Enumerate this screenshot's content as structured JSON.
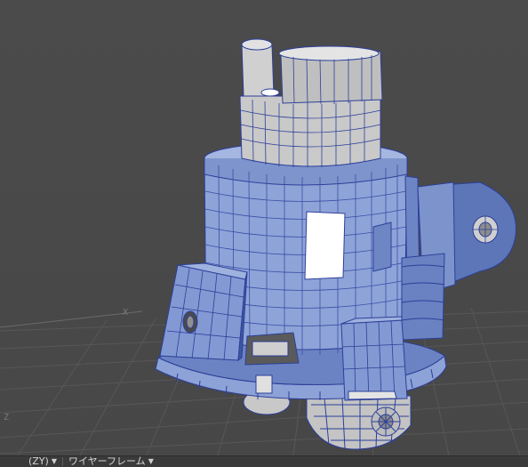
{
  "viewport": {
    "axis_labels": {
      "x_axis": "X",
      "z_axis": "Z"
    },
    "colors": {
      "background": "#4a4a4a",
      "grid": "#5a5a5a",
      "model_fill": "#7f97cf",
      "model_fill_light": "#9fb2de",
      "model_fill_dark": "#4f67a8",
      "wire": "#2d3f9a",
      "gray_fill": "#a9a9a9",
      "gray_light": "#d4d4d4"
    }
  },
  "statusbar": {
    "view_dropdown": {
      "label": "(ZY)",
      "icon": "triangle-down-icon"
    },
    "mode_dropdown": {
      "label": "ワイヤーフレーム",
      "icon": "triangle-down-icon"
    }
  }
}
